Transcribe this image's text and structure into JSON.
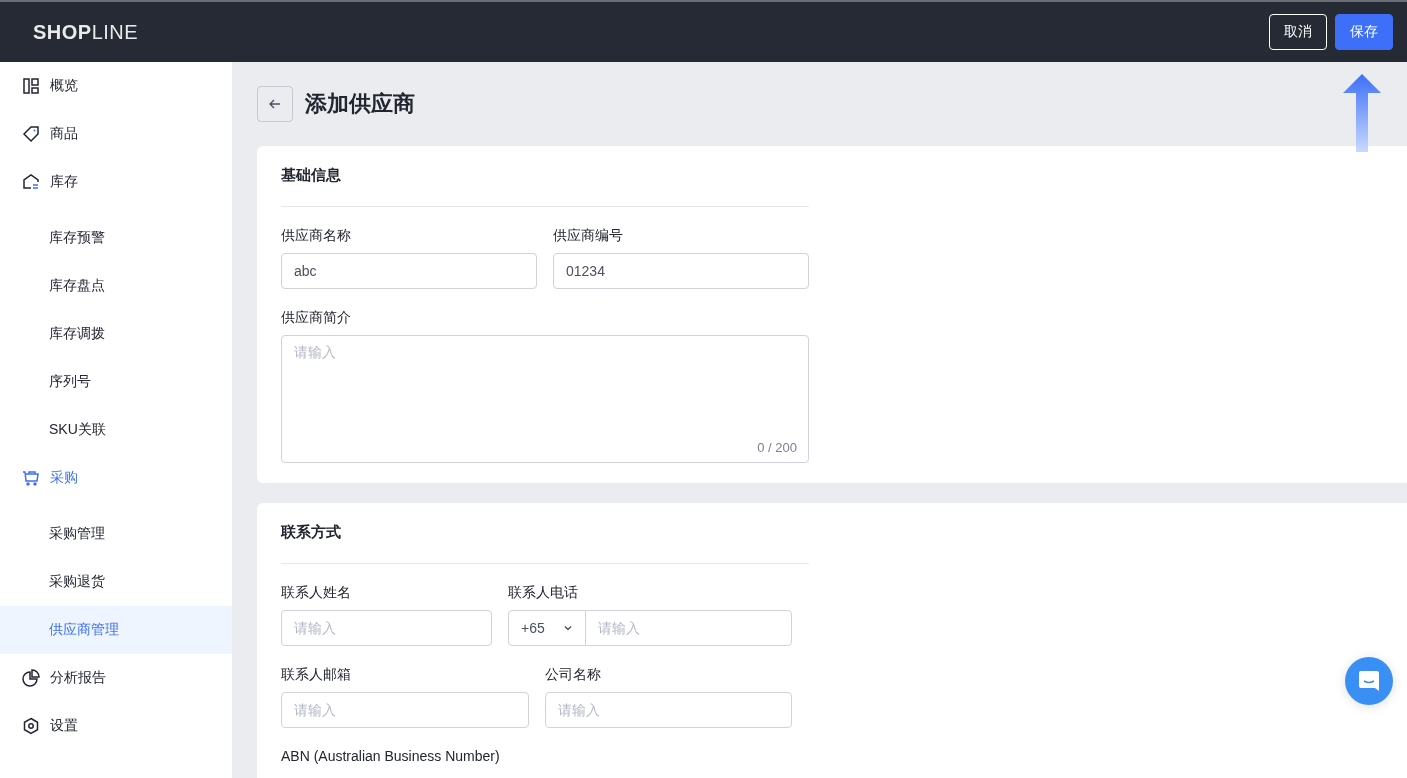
{
  "header": {
    "logo": "**SHOP**LINE",
    "buttons": [
      {
        "label": "取消",
        "kind": "secondary"
      },
      {
        "label": "保存",
        "kind": "primary"
      }
    ]
  },
  "sidebar": {
    "items": [
      {
        "label": "概览",
        "active": false
      },
      {
        "label": "商品",
        "active": false
      },
      {
        "label": "库存",
        "active": false,
        "children": [
          {
            "label": "库存预警",
            "selected": false
          },
          {
            "label": "库存盘点",
            "selected": false
          },
          {
            "label": "库存调拨",
            "selected": false
          },
          {
            "label": "序列号",
            "selected": false
          },
          {
            "label": "SKU关联",
            "selected": false
          }
        ]
      },
      {
        "label": "采购",
        "active": true,
        "children": [
          {
            "label": "采购管理",
            "selected": false
          },
          {
            "label": "采购退货",
            "selected": false
          },
          {
            "label": "供应商管理",
            "selected": true
          }
        ]
      },
      {
        "label": "分析报告",
        "active": false
      },
      {
        "label": "设置",
        "active": false
      }
    ]
  },
  "page": {
    "title": "添加供应商"
  },
  "sections": [
    {
      "title": "基础信息",
      "rows": [
        [
          {
            "label": "供应商名称",
            "kind": "text",
            "value": "abc"
          },
          {
            "label": "供应商编号",
            "kind": "text",
            "value": "01234"
          }
        ],
        [
          {
            "label": "供应商简介",
            "kind": "textarea",
            "placeholder": "请输入",
            "counter": "0 / 200"
          }
        ]
      ]
    },
    {
      "title": "联系方式",
      "rows": [
        [
          {
            "label": "联系人姓名",
            "kind": "text",
            "placeholder": "请输入"
          },
          {
            "label": "联系人电话",
            "kind": "phone",
            "prefix": "+65",
            "placeholder": "请输入"
          }
        ],
        [
          {
            "label": "联系人邮箱",
            "kind": "text",
            "placeholder": "请输入"
          },
          {
            "label": "公司名称",
            "kind": "text",
            "placeholder": "请输入"
          }
        ],
        [
          {
            "label": "ABN (Australian Business Number)",
            "kind": "label"
          }
        ]
      ]
    }
  ]
}
